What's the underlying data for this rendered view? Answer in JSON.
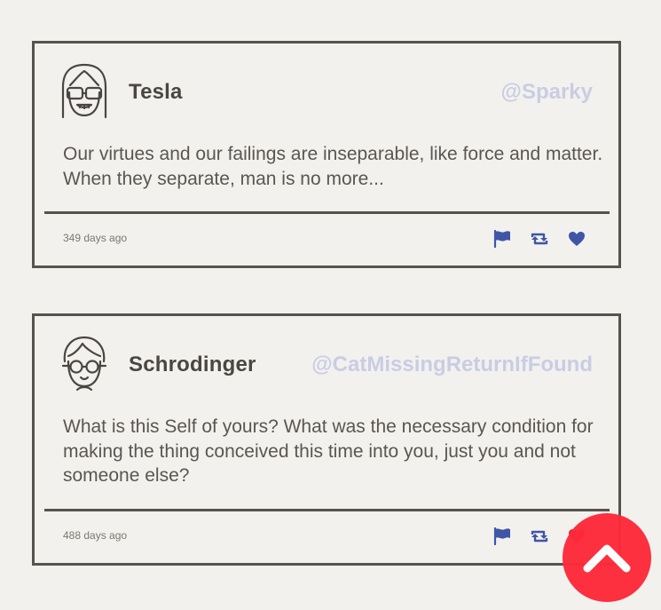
{
  "feed": {
    "posts": [
      {
        "author": "Tesla",
        "handle": "@Sparky",
        "text": "Our virtues and our failings are inseparable, like force and matter. When they separate, man is no more...",
        "time": "349 days ago",
        "avatar_icon": "scientist-goggles-avatar-icon",
        "liked": false
      },
      {
        "author": "Schrodinger",
        "handle": "@CatMissingReturnIfFound",
        "text": "What is this Self of yours? What was the necessary condition for making the thing conceived this time into you, just you and not someone else?",
        "time": "488 days ago",
        "avatar_icon": "scientist-glasses-avatar-icon",
        "liked": true
      }
    ],
    "actions": {
      "flag_icon": "flag-icon",
      "retweet_icon": "retweet-icon",
      "like_icon": "heart-icon"
    }
  },
  "colors": {
    "background": "#f3f1ee",
    "border": "#57534e",
    "handle": "#c9cde3",
    "action_blue": "#3f56a6",
    "liked_red": "#e8243a",
    "scroll_top_button": "#fe2a3a"
  },
  "scroll_top": {
    "icon": "chevron-up-icon"
  }
}
